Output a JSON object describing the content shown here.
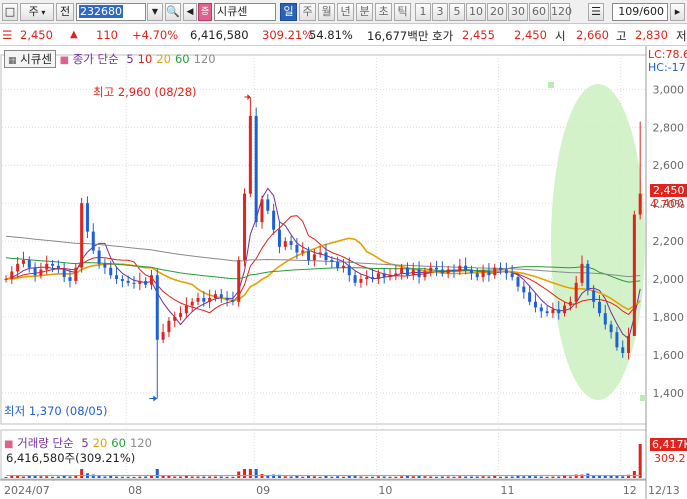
{
  "toolbar": {
    "market": "주",
    "chart_type": "전",
    "code": "232680",
    "name": "시큐센",
    "periods": [
      "일",
      "주",
      "월",
      "년",
      "분",
      "초",
      "틱"
    ],
    "active_period": "일",
    "intervals": [
      "1",
      "3",
      "5",
      "10",
      "20",
      "30",
      "60",
      "120"
    ],
    "count": "109/600"
  },
  "quote": {
    "price": "2,450",
    "arrow": "▲",
    "change": "110",
    "change_pct": "+4.70%",
    "volume": "6,416,580",
    "vol_ratio": "309.21%",
    "turnover": "54.81%",
    "amount": "16,677백만",
    "ask_label": "호가",
    "ask": "2,455",
    "bid": "2,450",
    "open_label": "시",
    "open": "2,660",
    "high_label": "고",
    "high": "2,830",
    "low_label": "저"
  },
  "price_panel": {
    "name_tab": "시큐센",
    "legend_label": "종가 단순",
    "ma_periods": [
      "5",
      "10",
      "20",
      "60",
      "120"
    ],
    "ma_colors": [
      "#7030a0",
      "#e0231c",
      "#e8a000",
      "#2a9a3a",
      "#8a8a8a"
    ],
    "lc_label": "LC:78.6",
    "hc_label": "HC:-17",
    "current_price_label": "2,450",
    "current_pct_label": "4.70%",
    "high_annotation": "최고 2,960 (08/28)",
    "low_annotation": "최저 1,370 (08/05)"
  },
  "volume_panel": {
    "legend_label": "거래량 단순",
    "ma_periods": [
      "5",
      "20",
      "60",
      "120"
    ],
    "current_volume": "6,416,580주(309.21%)",
    "side_value": "6,417K",
    "side_pct": "309.2"
  },
  "x_axis": {
    "labels": [
      "2024/07",
      "08",
      "09",
      "10",
      "11",
      "12",
      "12/13"
    ]
  },
  "colors": {
    "up": "#e0231c",
    "down": "#1f5fd6",
    "highlight": "#ccf0c0"
  },
  "chart_data": {
    "type": "candlestick",
    "y_ticks": [
      1400,
      1600,
      1800,
      2000,
      2200,
      2400,
      2600,
      2800,
      3000
    ],
    "y_range": [
      1320,
      3060
    ],
    "volume_ticks": [],
    "series": [
      {
        "name": "close",
        "values": [
          2000,
          2040,
          2080,
          2100,
          2060,
          2020,
          2050,
          2080,
          2070,
          2050,
          2010,
          1990,
          2060,
          2400,
          2250,
          2150,
          2080,
          2060,
          2020,
          2000,
          1990,
          1980,
          1975,
          1990,
          1970,
          2020,
          1680,
          1720,
          1780,
          1800,
          1820,
          1860,
          1880,
          1900,
          1880,
          1900,
          1920,
          1900,
          1890,
          1880,
          2100,
          2450,
          2860,
          2300,
          2420,
          2360,
          2260,
          2170,
          2200,
          2180,
          2140,
          2150,
          2100,
          2130,
          2140,
          2100,
          2090,
          2060,
          2070,
          2020,
          1980,
          2000,
          2010,
          2000,
          2030,
          2010,
          2020,
          2030,
          2060,
          2020,
          2050,
          2010,
          2040,
          2060,
          2050,
          2030,
          2050,
          2040,
          2070,
          2050,
          2030,
          2010,
          2040,
          2020,
          2060,
          2050,
          2030,
          2010,
          1960,
          1930,
          1880,
          1850,
          1830,
          1820,
          1840,
          1820,
          1860,
          1880,
          1980,
          2080,
          1940,
          1880,
          1820,
          1760,
          1720,
          1640,
          1610,
          1700,
          2340,
          2450
        ]
      }
    ]
  }
}
